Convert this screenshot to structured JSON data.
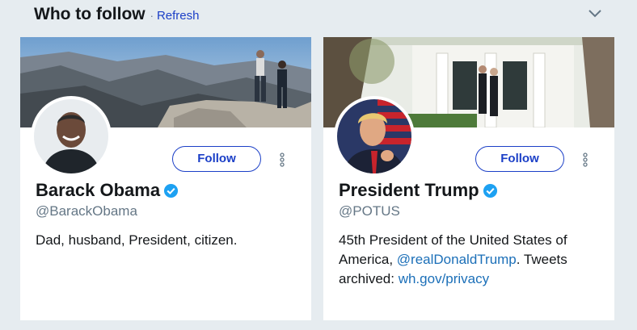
{
  "header": {
    "title": "Who to follow",
    "separator": "·",
    "refresh_label": "Refresh",
    "collapse_icon": "chevron-down-icon"
  },
  "accent_color": "#1b3fc7",
  "link_color": "#1b6fb8",
  "cards": [
    {
      "name": "Barack Obama",
      "verified": true,
      "handle": "@BarackObama",
      "bio": "Dad, husband, President, citizen.",
      "follow_label": "Follow",
      "more_icon": "more-vertical-icon"
    },
    {
      "name": "President Trump",
      "verified": true,
      "handle": "@POTUS",
      "bio_part1": "45th President of the United States of America, ",
      "bio_link1": "@realDonaldTrump",
      "bio_part2": ". Tweets archived: ",
      "bio_link2": "wh.gov/privacy",
      "follow_label": "Follow",
      "more_icon": "more-vertical-icon"
    }
  ]
}
